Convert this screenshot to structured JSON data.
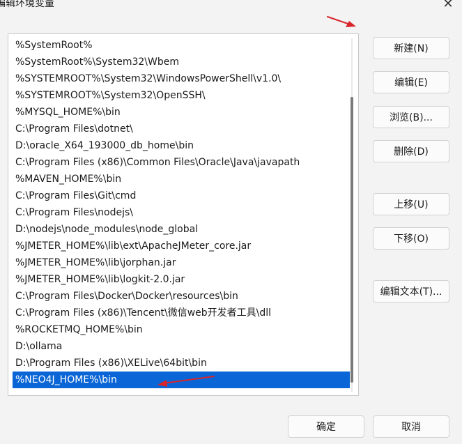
{
  "dialog": {
    "title": "编辑环境变量",
    "close_icon": "close-icon"
  },
  "list": {
    "items": [
      "%SystemRoot%",
      "%SystemRoot%\\System32\\Wbem",
      "%SYSTEMROOT%\\System32\\WindowsPowerShell\\v1.0\\",
      "%SYSTEMROOT%\\System32\\OpenSSH\\",
      "%MYSQL_HOME%\\bin",
      "C:\\Program Files\\dotnet\\",
      "D:\\oracle_X64_193000_db_home\\bin",
      "C:\\Program Files (x86)\\Common Files\\Oracle\\Java\\javapath",
      "%MAVEN_HOME%\\bin",
      "C:\\Program Files\\Git\\cmd",
      "C:\\Program Files\\nodejs\\",
      "D:\\nodejs\\node_modules\\node_global",
      "%JMETER_HOME%\\lib\\ext\\ApacheJMeter_core.jar",
      "%JMETER_HOME%\\lib\\jorphan.jar",
      "%JMETER_HOME%\\lib\\logkit-2.0.jar",
      "C:\\Program Files\\Docker\\Docker\\resources\\bin",
      "C:\\Program Files (x86)\\Tencent\\微信web开发者工具\\dll",
      "%ROCKETMQ_HOME%\\bin",
      "D:\\ollama",
      "D:\\Program Files (x86)\\XELive\\64bit\\bin",
      "%NEO4J_HOME%\\bin"
    ],
    "selected_index": 20
  },
  "buttons": {
    "new": "新建(N)",
    "edit": "编辑(E)",
    "browse": "浏览(B)...",
    "delete": "删除(D)",
    "move_up": "上移(U)",
    "move_down": "下移(O)",
    "edit_text": "编辑文本(T)...",
    "ok": "确定",
    "cancel": "取消"
  },
  "colors": {
    "selection": "#0a66d6",
    "annotation_arrow": "#d9262c"
  }
}
